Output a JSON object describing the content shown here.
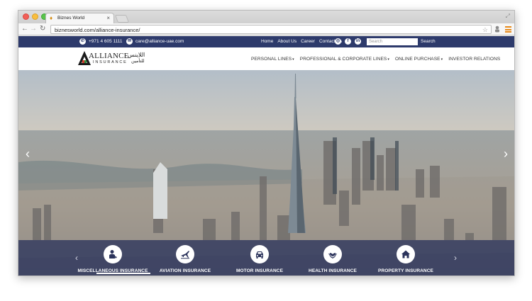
{
  "browser": {
    "tab_title": "Biznes World",
    "tab_close": "×",
    "url": "biznesworld.com/alliance-insurance/"
  },
  "topbar": {
    "phone": "+971 4 605 1111",
    "email": "care@alliance-uae.com",
    "links": [
      "Home",
      "About Us",
      "Career",
      "Contact Us"
    ],
    "social_icons": [
      "instagram-icon",
      "facebook-icon",
      "linkedin-icon"
    ],
    "search_placeholder": "Search",
    "search_button": "Search"
  },
  "logo": {
    "name": "ALLIANCE",
    "sub": "INSURANCE",
    "arabic_name": "اللاينس",
    "arabic_sub": "للتأمين"
  },
  "nav": {
    "items": [
      {
        "label": "PERSONAL LINES",
        "dropdown": true
      },
      {
        "label": "PROFESSIONAL & CORPORATE LINES",
        "dropdown": true
      },
      {
        "label": "ONLINE PURCHASE",
        "dropdown": true
      },
      {
        "label": "INVESTOR RELATIONS",
        "dropdown": false
      }
    ]
  },
  "hero": {
    "prev_arrow": "‹",
    "next_arrow": "›"
  },
  "insurance_strip": {
    "prev_arrow": "‹",
    "next_arrow": "›",
    "items": [
      {
        "label": "MISCELLANEOUS INSURANCE",
        "icon": "person-icon"
      },
      {
        "label": "AVIATION INSURANCE",
        "icon": "plane-icon"
      },
      {
        "label": "MOTOR INSURANCE",
        "icon": "car-icon"
      },
      {
        "label": "HEALTH INSURANCE",
        "icon": "heart-hand-icon"
      },
      {
        "label": "PROPERTY INSURANCE",
        "icon": "house-icon"
      }
    ]
  },
  "colors": {
    "topbar": "#2d3a6b",
    "strip": "#2c345c",
    "accent_orange": "#e88a1a"
  }
}
